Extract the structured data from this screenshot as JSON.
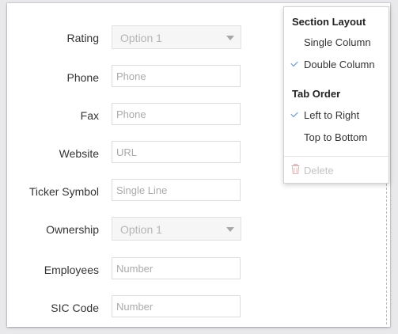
{
  "form": {
    "fields": [
      {
        "label": "Rating",
        "type": "select",
        "value": "Option 1"
      },
      {
        "label": "Phone",
        "type": "input",
        "placeholder": "Phone"
      },
      {
        "label": "Fax",
        "type": "input",
        "placeholder": "Phone"
      },
      {
        "label": "Website",
        "type": "input",
        "placeholder": "URL"
      },
      {
        "label": "Ticker Symbol",
        "type": "input",
        "placeholder": "Single Line"
      },
      {
        "label": "Ownership",
        "type": "select",
        "value": "Option 1"
      },
      {
        "label": "Employees",
        "type": "input",
        "placeholder": "Number"
      },
      {
        "label": "SIC Code",
        "type": "input",
        "placeholder": "Number"
      }
    ]
  },
  "menu": {
    "section_layout_heading": "Section Layout",
    "single_column": "Single Column",
    "double_column": "Double Column",
    "tab_order_heading": "Tab Order",
    "left_to_right": "Left to Right",
    "top_to_bottom": "Top to Bottom",
    "delete": "Delete",
    "selected": {
      "layout": "Double Column",
      "tab_order": "Left to Right"
    },
    "check_color": "#5b8fc7",
    "delete_icon": "trash-icon"
  }
}
